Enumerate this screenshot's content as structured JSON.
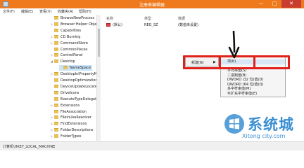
{
  "window": {
    "title": "注册表编辑器",
    "minimize": "—",
    "maximize": "□",
    "close": "✕"
  },
  "menubar": [
    "文件(F)",
    "编辑(E)",
    "查看(V)",
    "收藏夹(A)",
    "帮助(H)"
  ],
  "tree": {
    "items": [
      {
        "label": "BrowseNewProcess",
        "expander": ""
      },
      {
        "label": "Browser Helper Objects",
        "expander": "▷"
      },
      {
        "label": "Capabilities",
        "expander": ""
      },
      {
        "label": "CD Burning",
        "expander": "▷"
      },
      {
        "label": "CommandStore",
        "expander": "▷"
      },
      {
        "label": "CommonPlaces",
        "expander": ""
      },
      {
        "label": "ControlPanel",
        "expander": "▷"
      },
      {
        "label": "Desktop",
        "expander": "◢"
      },
      {
        "label": "NameSpace",
        "expander": "",
        "indent": true,
        "selected": true
      },
      {
        "label": "DesktopIniPropertyMap",
        "expander": "▷"
      },
      {
        "label": "DesktopOptimization",
        "expander": ""
      },
      {
        "label": "DeviceUpdateLocations",
        "expander": ""
      },
      {
        "label": "DriveIcons",
        "expander": ""
      },
      {
        "label": "ExecuteTypeDelegates",
        "expander": ""
      },
      {
        "label": "Extensions",
        "expander": "▷"
      },
      {
        "label": "FileAssociation",
        "expander": ""
      },
      {
        "label": "FileInUseResolver",
        "expander": "▷"
      },
      {
        "label": "FindExtensions",
        "expander": "▷"
      },
      {
        "label": "FolderDescriptions",
        "expander": "▷"
      },
      {
        "label": "FolderTypes",
        "expander": "▷"
      }
    ]
  },
  "list": {
    "columns": [
      "名称",
      "类型",
      "数据"
    ],
    "rows": [
      {
        "name": "(默认)",
        "type": "REG_SZ",
        "data": "(数值未设置)"
      }
    ]
  },
  "context_menu": {
    "new_label": "新建(N)",
    "arrow": "▶"
  },
  "submenu": {
    "items": [
      "项(K)",
      "字符串值(S)",
      "二进制值(B)",
      "DWORD (32 位)值(D)",
      "QWORD (64 位)值(Q)",
      "多字符串值(M)",
      "可扩充字符串值(E)"
    ]
  },
  "status": {
    "path": "计算机\\HKEY_LOCAL_MACHINE"
  },
  "watermark": {
    "cn": "系统城",
    "en": "Xitong city.com"
  },
  "colors": {
    "titlebar": "#ee7a1d",
    "annotation_red": "#e0201b",
    "watermark_blue": "#3a8fd2"
  },
  "icons": {
    "app": "regedit-icon",
    "folder": "folder-icon",
    "value": "reg-string-icon",
    "annotation": "black-down-arrow-icon"
  }
}
